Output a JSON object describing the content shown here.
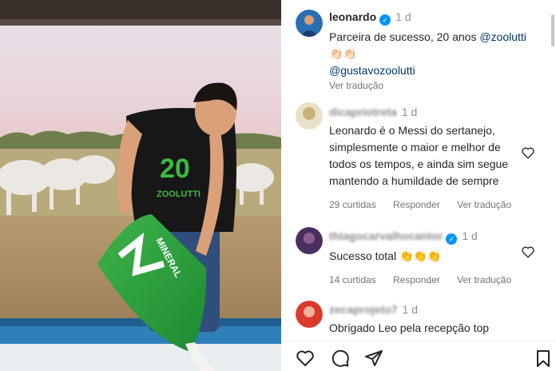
{
  "post": {
    "author": "leonardo",
    "time": "1 d",
    "caption": "Parceira de sucesso, 20 anos",
    "caption_mention": "@zoolutti",
    "caption_emoji": "👏🏻👏🏻",
    "caption_mention2": "@gustavozoolutti",
    "translate": "Ver tradução"
  },
  "comments": [
    {
      "username": "dicapriotreta",
      "time": "1 d",
      "text": "Leonardo é o Messi do sertanejo, simplesmente o maior e melhor de todos os tempos, e ainda sim segue mantendo a humildade de sempre",
      "likes": "29 curtidas",
      "reply": "Responder",
      "translate": "Ver tradução"
    },
    {
      "username": "thiagocarvalhocantor",
      "time": "1 d",
      "text": "Sucesso total 👏👏👏",
      "likes": "14 curtidas",
      "reply": "Responder",
      "translate": "Ver tradução"
    },
    {
      "username": "zecaprojeto7",
      "time": "1 d",
      "text": "Obrigado Leo pela recepção top"
    }
  ],
  "photo": {
    "shirt_text": "20",
    "shirt_brand": "ZOOLUTTI",
    "bag_text": "MINERAL"
  },
  "colors": {
    "link": "#00376b",
    "verified": "#0095f6",
    "secondary_text": "#737373"
  },
  "icons": [
    "heart-icon",
    "comment-icon",
    "share-icon",
    "bookmark-icon",
    "verified-icon"
  ]
}
